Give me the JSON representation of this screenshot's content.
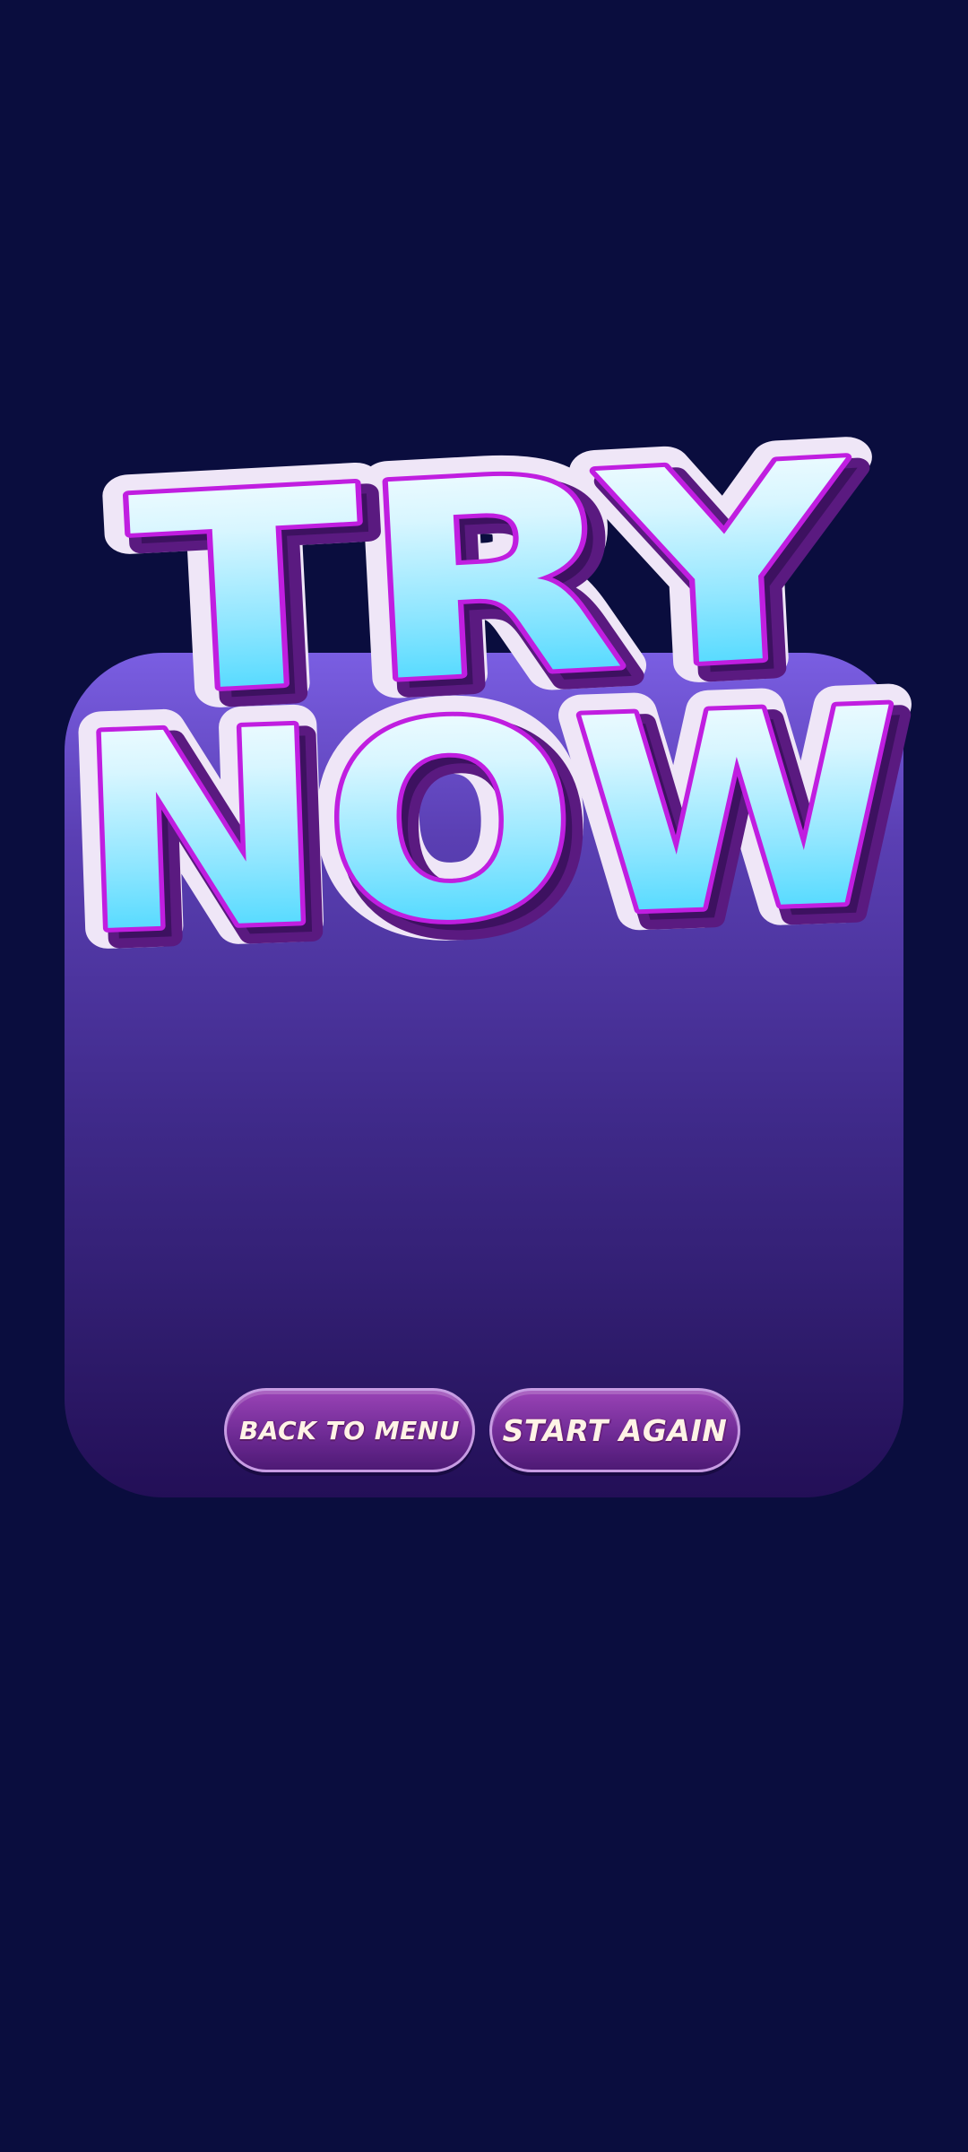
{
  "title": {
    "line1": "TRY",
    "line2": "NOW"
  },
  "buttons": {
    "back_to_menu": "BACK TO MENU",
    "start_again": "START AGAIN"
  },
  "colors": {
    "background": "#0a0d3e",
    "panel_top": "#7a5ee2",
    "panel_bottom": "#230f57",
    "title_fill_top": "#ffffff",
    "title_fill_bottom": "#22d0ff",
    "title_outline": "#c01ee0",
    "title_shadow": "#4a1468",
    "button_fill": "#7a2f9e"
  }
}
